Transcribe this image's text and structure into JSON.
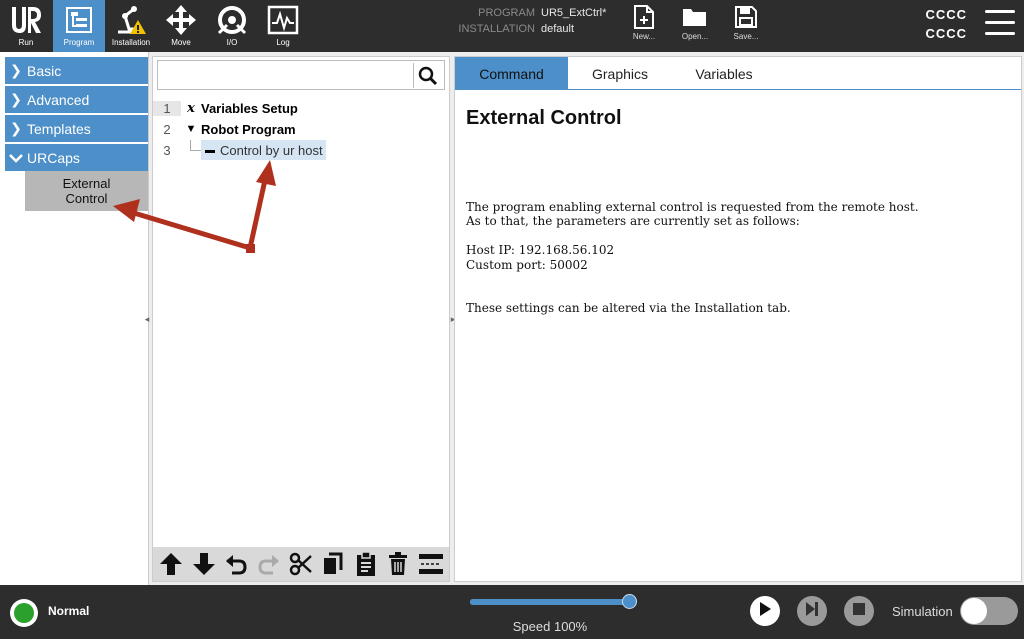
{
  "topbar": {
    "nav": [
      {
        "label": "Run",
        "icon": "ur-logo-icon"
      },
      {
        "label": "Program",
        "icon": "program-icon",
        "active": true
      },
      {
        "label": "Installation",
        "icon": "installation-icon"
      },
      {
        "label": "Move",
        "icon": "move-icon"
      },
      {
        "label": "I/O",
        "icon": "io-icon"
      },
      {
        "label": "Log",
        "icon": "log-icon"
      }
    ],
    "program_key": "PROGRAM",
    "program_value": "UR5_ExtCtrl*",
    "installation_key": "INSTALLATION",
    "installation_value": "default",
    "file_buttons": [
      {
        "label": "New...",
        "icon": "new-file-icon"
      },
      {
        "label": "Open...",
        "icon": "open-folder-icon"
      },
      {
        "label": "Save...",
        "icon": "save-icon"
      }
    ],
    "status_top": "CCCC",
    "status_bottom": "CCCC"
  },
  "left_panel": {
    "categories": [
      {
        "label": "Basic",
        "expanded": false
      },
      {
        "label": "Advanced",
        "expanded": false
      },
      {
        "label": "Templates",
        "expanded": false
      },
      {
        "label": "URCaps",
        "expanded": true
      }
    ],
    "urcap_item_line1": "External",
    "urcap_item_line2": "Control"
  },
  "tree": {
    "search_placeholder": "",
    "rows": [
      {
        "num": "1",
        "marker": "x",
        "label": "Variables Setup"
      },
      {
        "num": "2",
        "marker": "▼",
        "label": "Robot Program"
      },
      {
        "num": "3",
        "marker": "▬",
        "label": "Control by ur host"
      }
    ],
    "toolbar": [
      "move-up-icon",
      "move-down-icon",
      "undo-icon",
      "redo-icon",
      "cut-icon",
      "copy-icon",
      "paste-icon",
      "delete-icon",
      "suppress-icon"
    ]
  },
  "right_panel": {
    "tabs": [
      "Command",
      "Graphics",
      "Variables"
    ],
    "active_tab": "Command",
    "title": "External Control",
    "para1_line1": "The program enabling external control is requested from the remote host.",
    "para1_line2": "As to that, the parameters are currently set as follows:",
    "host_ip": "Host IP: 192.168.56.102",
    "custom_port": "Custom port: 50002",
    "para3": "These settings can be altered via the Installation tab."
  },
  "bottombar": {
    "status": "Normal",
    "status_color": "#2ca02c",
    "speed_label": "Speed 100%",
    "speed_value": 1.0,
    "simulation_label": "Simulation",
    "simulation_on": false
  },
  "colors": {
    "accent": "#4d8fc8",
    "annotation_arrow": "#b0301e"
  }
}
